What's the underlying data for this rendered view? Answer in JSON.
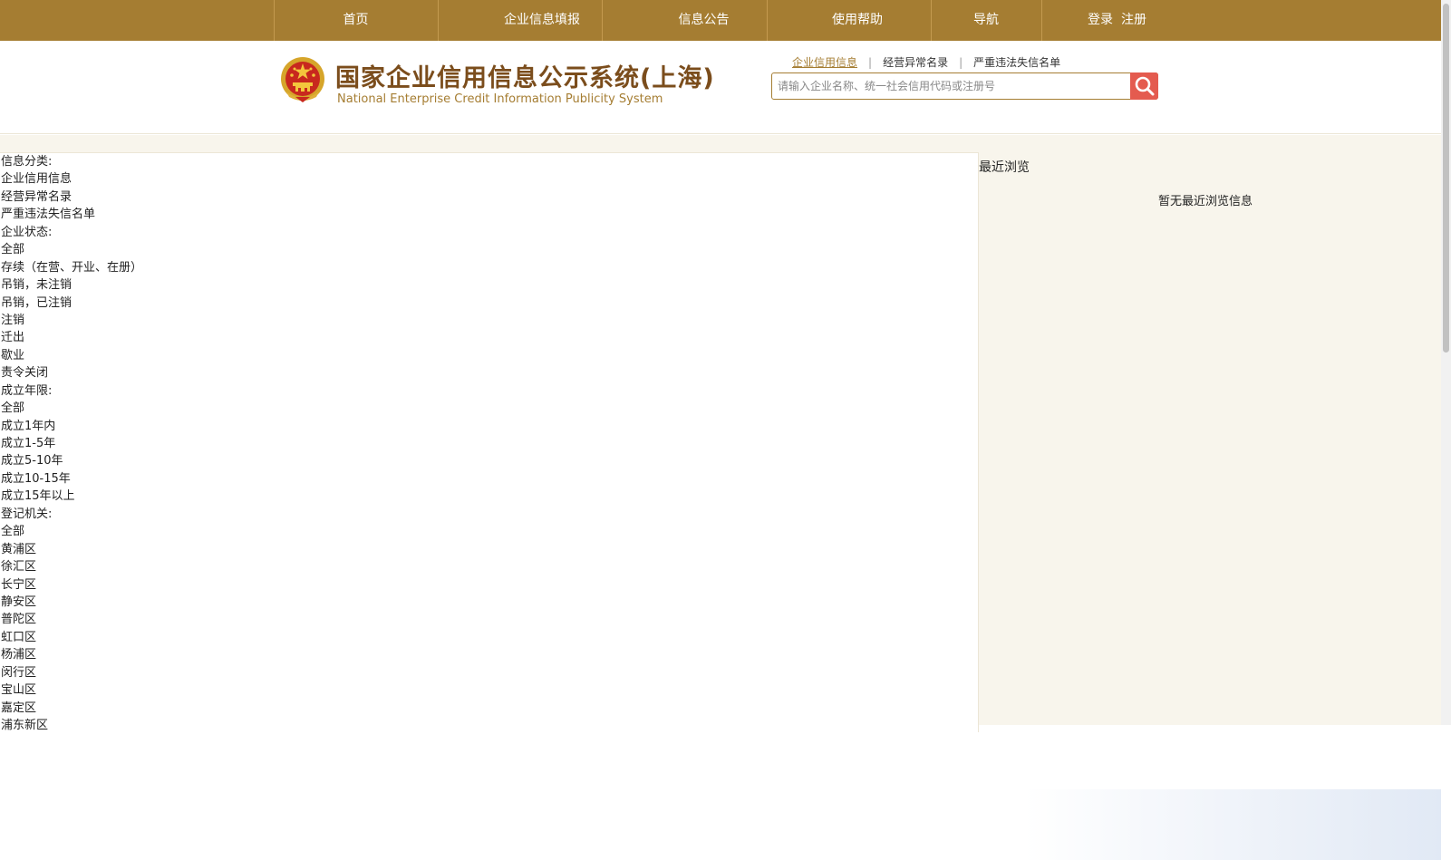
{
  "nav": {
    "items": [
      {
        "label": "首页"
      },
      {
        "label": "企业信息填报"
      },
      {
        "label": "信息公告"
      },
      {
        "label": "使用帮助"
      },
      {
        "label": "导航"
      }
    ],
    "login": "登录",
    "register": "注册"
  },
  "header": {
    "title": "国家企业信用信息公示系统(上海)",
    "subtitle": "National Enterprise Credit Information Publicity System",
    "emblem_icon": "national-emblem-icon"
  },
  "search": {
    "tabs": [
      "企业信用信息",
      "经营异常名录",
      "严重违法失信名单"
    ],
    "active_tab": 0,
    "placeholder": "请输入企业名称、统一社会信用代码或注册号",
    "value": "",
    "button_icon": "search-icon"
  },
  "filters": {
    "lines": [
      {
        "text": "信息分类:",
        "kind": "heading"
      },
      {
        "text": "企业信用信息",
        "kind": "option"
      },
      {
        "text": "经营异常名录",
        "kind": "option"
      },
      {
        "text": "严重违法失信名单",
        "kind": "option"
      },
      {
        "text": "企业状态:",
        "kind": "heading"
      },
      {
        "text": "全部",
        "kind": "option"
      },
      {
        "text": "存续（在营、开业、在册）",
        "kind": "option"
      },
      {
        "text": "吊销，未注销",
        "kind": "option"
      },
      {
        "text": "吊销，已注销",
        "kind": "option"
      },
      {
        "text": "注销",
        "kind": "option"
      },
      {
        "text": "迁出",
        "kind": "option"
      },
      {
        "text": "歇业",
        "kind": "option"
      },
      {
        "text": "责令关闭",
        "kind": "option"
      },
      {
        "text": "成立年限:",
        "kind": "heading"
      },
      {
        "text": "全部",
        "kind": "option"
      },
      {
        "text": "成立1年内",
        "kind": "option"
      },
      {
        "text": "成立1-5年",
        "kind": "option"
      },
      {
        "text": "成立5-10年",
        "kind": "option"
      },
      {
        "text": "成立10-15年",
        "kind": "option"
      },
      {
        "text": "成立15年以上",
        "kind": "option"
      },
      {
        "text": "登记机关:",
        "kind": "heading"
      },
      {
        "text": "全部",
        "kind": "option"
      },
      {
        "text": "黄浦区",
        "kind": "option"
      },
      {
        "text": "徐汇区",
        "kind": "option"
      },
      {
        "text": "长宁区",
        "kind": "option"
      },
      {
        "text": "静安区",
        "kind": "option"
      },
      {
        "text": "普陀区",
        "kind": "option"
      },
      {
        "text": "虹口区",
        "kind": "option"
      },
      {
        "text": "杨浦区",
        "kind": "option"
      },
      {
        "text": "闵行区",
        "kind": "option"
      },
      {
        "text": "宝山区",
        "kind": "option"
      },
      {
        "text": "嘉定区",
        "kind": "option"
      },
      {
        "text": "浦东新区",
        "kind": "option"
      }
    ]
  },
  "recent": {
    "title": "最近浏览",
    "empty_text": "暂无最近浏览信息"
  },
  "colors": {
    "nav_bg": "#a57d32",
    "title": "#7b4d1c",
    "accent": "#a57d32",
    "search_button": "#e45b4f"
  }
}
